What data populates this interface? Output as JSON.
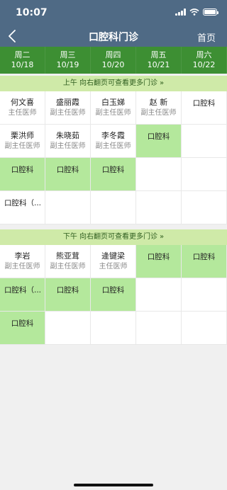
{
  "status_bar": {
    "time": "10:07"
  },
  "nav": {
    "back_icon": "chevron-left-icon",
    "title": "口腔科门诊",
    "home": "首页"
  },
  "week": [
    {
      "day": "周二",
      "date": "10/18"
    },
    {
      "day": "周三",
      "date": "10/19"
    },
    {
      "day": "周四",
      "date": "10/20"
    },
    {
      "day": "周五",
      "date": "10/21"
    },
    {
      "day": "周六",
      "date": "10/22"
    }
  ],
  "morning": {
    "header": "上午 向右翻页可查看更多门诊",
    "arrows": "»",
    "rows": [
      [
        {
          "name": "何文喜",
          "title": "主任医师"
        },
        {
          "name": "盛丽霞",
          "title": "副主任医师"
        },
        {
          "name": "白玉娣",
          "title": "副主任医师"
        },
        {
          "name": "赵 新",
          "title": "副主任医师"
        },
        {
          "dept": "口腔科"
        }
      ],
      [
        {
          "name": "栗洪师",
          "title": "副主任医师"
        },
        {
          "name": "朱晓茹",
          "title": "副主任医师"
        },
        {
          "name": "李冬霞",
          "title": "副主任医师"
        },
        {
          "dept": "口腔科"
        },
        {
          "empty": true
        }
      ],
      [
        {
          "dept": "口腔科"
        },
        {
          "dept": "口腔科"
        },
        {
          "dept": "口腔科"
        },
        {
          "empty": true
        },
        {
          "empty": true
        }
      ],
      [
        {
          "dept": "口腔科（..."
        },
        {
          "empty": true
        },
        {
          "empty": true
        },
        {
          "empty": true
        },
        {
          "empty": true
        }
      ]
    ]
  },
  "afternoon": {
    "header": "下午 向右翻页可查看更多门诊",
    "arrows": "»",
    "rows": [
      [
        {
          "name": "李岩",
          "title": "副主任医师"
        },
        {
          "name": "熊亚茸",
          "title": "副主任医师"
        },
        {
          "name": "逄键梁",
          "title": "主任医师"
        },
        {
          "dept": "口腔科"
        },
        {
          "dept": "口腔科"
        }
      ],
      [
        {
          "dept": "口腔科（..."
        },
        {
          "dept": "口腔科"
        },
        {
          "dept": "口腔科"
        },
        {
          "empty": true
        },
        {
          "empty": true
        }
      ],
      [
        {
          "dept": "口腔科"
        },
        {
          "empty": true
        },
        {
          "empty": true
        },
        {
          "empty": true
        },
        {
          "empty": true
        }
      ]
    ]
  },
  "colors": {
    "header_bg": "#4f6a85",
    "week_bg": "#3d8f33",
    "slot_green": "#b4e89c",
    "session_bg": "#cfeaa8"
  }
}
